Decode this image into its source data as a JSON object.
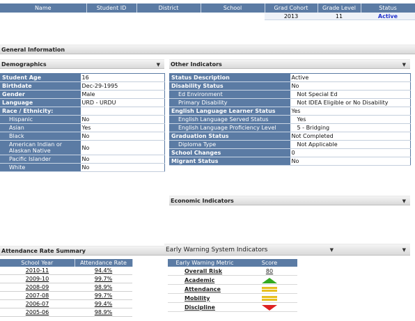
{
  "student_table": {
    "columns": [
      "Name",
      "Student ID",
      "District",
      "School",
      "Grad Cohort",
      "Grade Level",
      "Status"
    ],
    "row": {
      "name": "",
      "student_id": "",
      "district": "",
      "school": "",
      "grad_cohort": "2013",
      "grade_level": "11",
      "status": "Active"
    }
  },
  "general_info": {
    "title": "General Information"
  },
  "demographics": {
    "title": "Demographics",
    "rows": [
      {
        "label": "Student Age",
        "value": "16"
      },
      {
        "label": "Birthdate",
        "value": "Dec-29-1995"
      },
      {
        "label": "Gender",
        "value": "Male"
      },
      {
        "label": "Language",
        "value": "URD - URDU"
      },
      {
        "label": "Race / Ethnicity:",
        "value": ""
      },
      {
        "label": "Hispanic",
        "value": "No"
      },
      {
        "label": "Asian",
        "value": "Yes"
      },
      {
        "label": "Black",
        "value": "No"
      },
      {
        "label": "American Indian or Alaskan Native",
        "value": "No"
      },
      {
        "label": "Pacific Islander",
        "value": "No"
      },
      {
        "label": "White",
        "value": "No"
      }
    ]
  },
  "other_indicators": {
    "title": "Other Indicators",
    "rows": [
      {
        "label": "Status Description",
        "value": "Active"
      },
      {
        "label": "Disability Status",
        "value": "No"
      },
      {
        "label": "Ed Environment",
        "value": "Not Special Ed"
      },
      {
        "label": "Primary Disability",
        "value": "Not IDEA Eligible or No Disability"
      },
      {
        "label": "English Language Learner Status",
        "value": "Yes"
      },
      {
        "label": "English Language Served Status",
        "value": "Yes"
      },
      {
        "label": "English Language Proficiency Level",
        "value": "5 - Bridging"
      },
      {
        "label": "Graduation Status",
        "value": "Not Completed"
      },
      {
        "label": "Diploma Type",
        "value": "Not Applicable"
      },
      {
        "label": "School Changes",
        "value": "0"
      },
      {
        "label": "Migrant Status",
        "value": "No"
      }
    ]
  },
  "economic_indicators": {
    "title": "Economic Indicators"
  },
  "attendance": {
    "title": "Attendance Rate Summary",
    "columns": [
      "School Year",
      "Attendance Rate"
    ],
    "rows": [
      {
        "year": "2010-11",
        "rate": "94.4%"
      },
      {
        "year": "2009-10",
        "rate": "99.7%"
      },
      {
        "year": "2008-09",
        "rate": "98.9%"
      },
      {
        "year": "2007-08",
        "rate": "99.7%"
      },
      {
        "year": "2006-07",
        "rate": "99.4%"
      },
      {
        "year": "2005-06",
        "rate": "98.9%"
      }
    ]
  },
  "early_warning": {
    "title": "Early Warning System Indicators",
    "columns": [
      "Early Warning Metric",
      "Score"
    ],
    "rows": [
      {
        "metric": "Overall Risk",
        "score": "80",
        "indicator": "none"
      },
      {
        "metric": "Academic",
        "score": "",
        "indicator": "up-green"
      },
      {
        "metric": "Attendance",
        "score": "",
        "indicator": "equal-yellow"
      },
      {
        "metric": "Mobility",
        "score": "",
        "indicator": "equal-yellow"
      },
      {
        "metric": "Discipline",
        "score": "",
        "indicator": "down-red"
      }
    ],
    "colors": {
      "good": "#33aa22",
      "neutral": "#e8c020",
      "bad": "#dd2222"
    }
  },
  "icons": {
    "collapse": "dropdown-caret-icon"
  }
}
